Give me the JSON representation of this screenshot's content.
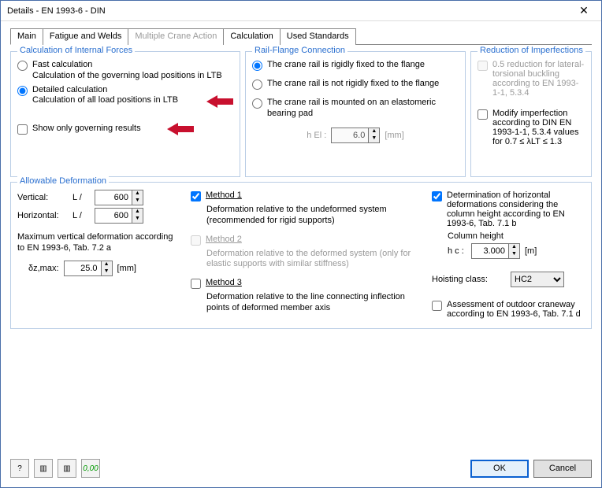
{
  "title": "Details - EN 1993-6 - DIN",
  "tabs": [
    "Main",
    "Fatigue and Welds",
    "Multiple Crane Action",
    "Calculation",
    "Used Standards"
  ],
  "g1": {
    "legend": "Calculation of Internal Forces",
    "r1": "Fast calculation",
    "r1d": "Calculation of the governing load positions in LTB",
    "r2": "Detailed calculation",
    "r2d": "Calculation of all load positions in LTB",
    "cb": "Show only governing results"
  },
  "g2": {
    "legend": "Rail-Flange Connection",
    "r1": "The crane rail is rigidly fixed to the flange",
    "r2": "The crane rail is not rigidly fixed to the flange",
    "r3": "The crane rail is mounted on an elastomeric bearing pad",
    "hEl": "h El :",
    "hElVal": "6.0",
    "hElUnit": "[mm]"
  },
  "g3": {
    "legend": "Reduction of Imperfections",
    "cb1": "0.5 reduction for lateral-torsional buckling according to EN 1993-1-1, 5.3.4",
    "cb2": "Modify imperfection according to DIN EN 1993-1-1, 5.3.4 values for 0.7 ≤ λLT ≤ 1.3"
  },
  "g4": {
    "legend": "Allowable Deformation",
    "vertical": "Vertical:",
    "horizontal": "Horizontal:",
    "Lslash": "L /",
    "val600": "600",
    "maxVertDef": "Maximum vertical deformation according to EN 1993-6, Tab. 7.2 a",
    "dzmax": "δz,max:",
    "dzmaxVal": "25.0",
    "mm": "[mm]",
    "m1": "Method 1",
    "m1d": "Deformation relative to the undeformed system (recommended for rigid supports)",
    "m2": "Method 2",
    "m2d": "Deformation relative to the deformed system (only for elastic supports with similar stiffness)",
    "m3": "Method 3",
    "m3d": "Deformation relative to the line connecting inflection points of deformed member axis",
    "detHoriz": "Determination of horizontal deformations considering the column height according to EN 1993-6, Tab. 7.1 b",
    "colHeight": "Column height",
    "hc": "h c :",
    "hcVal": "3.000",
    "mUnit": "[m]",
    "hoist": "Hoisting class:",
    "hoistVal": "HC2",
    "outdoor": "Assessment of outdoor craneway according to EN 1993-6, Tab. 7.1 d"
  },
  "footer": {
    "ok": "OK",
    "cancel": "Cancel"
  }
}
